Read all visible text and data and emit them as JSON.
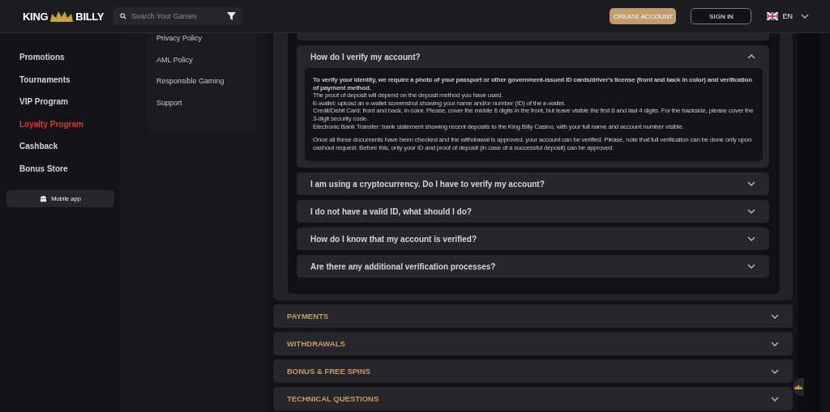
{
  "header": {
    "logo": {
      "left": "KING",
      "right": "BILLY"
    },
    "search": {
      "placeholder": "Search Your Games"
    },
    "create_account": "CREATE ACCOUNT",
    "sign_in": "SIGN IN",
    "language": "EN"
  },
  "sidebar": {
    "items": [
      {
        "label": "Promotions",
        "selected": false
      },
      {
        "label": "Tournaments",
        "selected": false
      },
      {
        "label": "VIP Program",
        "selected": false
      },
      {
        "label": "Loyalty Program",
        "selected": true
      },
      {
        "label": "Cashback",
        "selected": false
      },
      {
        "label": "Bonus Store",
        "selected": false
      }
    ],
    "mobile_app": "Mobile app"
  },
  "info_links": [
    "Privacy Policy",
    "AML Policy",
    "Responsible Gaming",
    "Support"
  ],
  "questions": [
    {
      "question": "How do I verify my account?",
      "expanded": true,
      "answer": [
        "**To verify your identity, we require a photo of your passport or other government-issued ID cards/driver's license (front and back in color) and verification of payment method.**",
        "The proof of deposit will depend on the deposit method you have used.",
        "E-wallet: upload an e-wallet screenshot showing your name and/or number (ID) of the e-wallet.",
        "Credit/Debit Card: front and back, in color. Please, cover the middle 6 digits in the front, but leave visible the first 6 and last 4 digits. For the backside, please cover the 3-digit security code.",
        "Electronic Bank Transfer: bank statement showing recent deposits to the King Billy Casino, with your full name and account number visible.",
        "Once all these documents have been checked and the withdrawal is approved, your account can be verified. Please, note that full verification can be done only upon cashout request. Before this, only your ID and proof of deposit (in case of a successful deposit) can be approved."
      ]
    },
    {
      "question": "I am using a cryptocurrency. Do I have to verify my account?",
      "expanded": false
    },
    {
      "question": "I do not have a valid ID, what should I do?",
      "expanded": false
    },
    {
      "question": "How do I know that my account is verified?",
      "expanded": false
    },
    {
      "question": "Are there any additional verification processes?",
      "expanded": false
    }
  ],
  "categories": [
    {
      "title": "PAYMENTS",
      "expanded": false
    },
    {
      "title": "WITHDRAWALS",
      "expanded": false
    },
    {
      "title": "BONUS & FREE SPINS",
      "expanded": false
    },
    {
      "title": "TECHNICAL QUESTIONS",
      "expanded": false
    }
  ]
}
